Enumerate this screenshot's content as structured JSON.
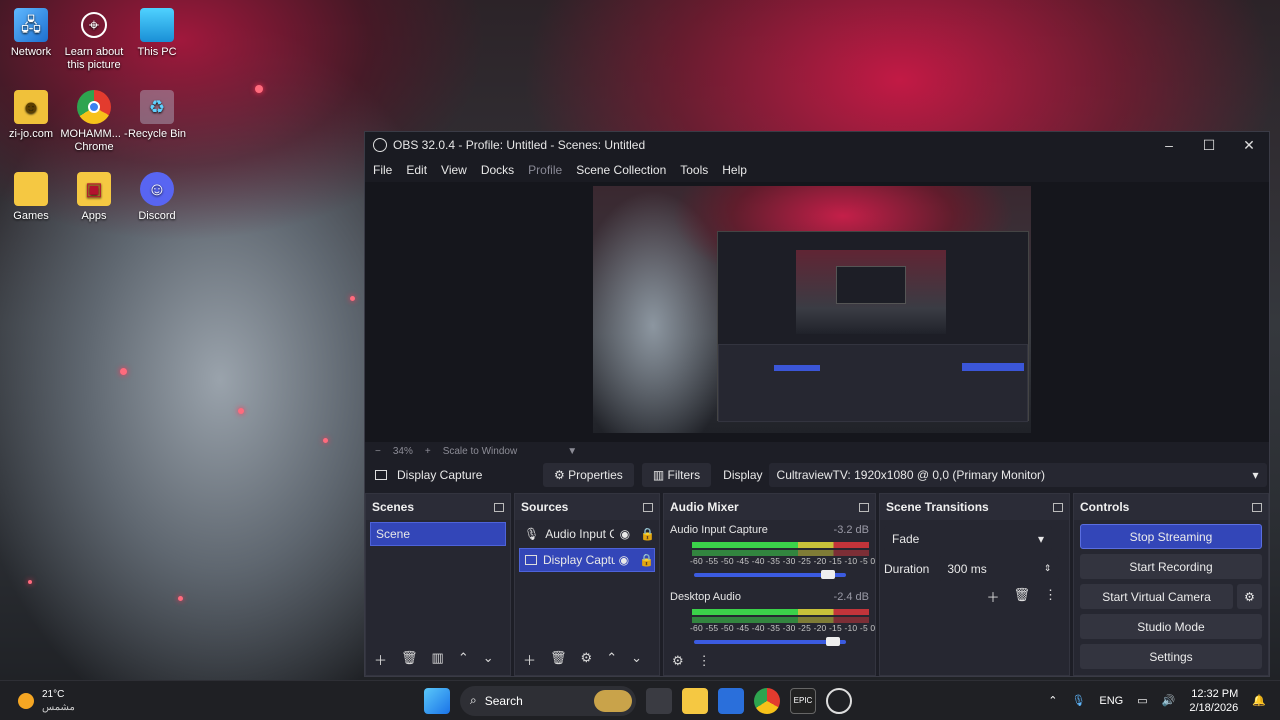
{
  "desktop": {
    "icons": [
      {
        "label": "Network",
        "icon": "network-icon"
      },
      {
        "label": "Learn about this picture",
        "icon": "learn-icon"
      },
      {
        "label": "This PC",
        "icon": "this-pc-icon"
      },
      {
        "label": "zi-jo.com",
        "icon": "user-folder-icon"
      },
      {
        "label": "MOHAMM... - Chrome",
        "icon": "chrome-icon"
      },
      {
        "label": "Recycle Bin",
        "icon": "recycle-bin-icon"
      },
      {
        "label": "Games",
        "icon": "folder-icon"
      },
      {
        "label": "Apps",
        "icon": "apps-folder-icon"
      },
      {
        "label": "Discord",
        "icon": "discord-icon"
      }
    ]
  },
  "obs": {
    "title": "OBS 32.0.4 - Profile: Untitled - Scenes: Untitled",
    "menu": [
      "File",
      "Edit",
      "View",
      "Docks",
      "Profile",
      "Scene Collection",
      "Tools",
      "Help"
    ],
    "zoom": {
      "minus": "−",
      "level": "34%",
      "plus": "+",
      "scale_mode": "Scale to Window"
    },
    "source_bar": {
      "source_name": "Display Capture",
      "properties": "Properties",
      "filters": "Filters",
      "display_label": "Display",
      "display_value": "CultraviewTV: 1920x1080 @ 0,0 (Primary Monitor)"
    },
    "scenes": {
      "title": "Scenes",
      "items": [
        "Scene"
      ]
    },
    "sources": {
      "title": "Sources",
      "items": [
        "Audio Input C",
        "Display Captu"
      ]
    },
    "mixer": {
      "title": "Audio Mixer",
      "ticks": "-60 -55 -50 -45 -40 -35 -30 -25 -20 -15 -10 -5 0",
      "channels": [
        {
          "name": "Audio Input Capture",
          "db": "-3.2 dB",
          "level": 0.93
        },
        {
          "name": "Desktop Audio",
          "db": "-2.4 dB",
          "level": 0.96
        }
      ]
    },
    "transitions": {
      "title": "Scene Transitions",
      "type": "Fade",
      "duration_label": "Duration",
      "duration_value": "300 ms"
    },
    "controls": {
      "title": "Controls",
      "stop_streaming": "Stop Streaming",
      "start_recording": "Start Recording",
      "start_virtual_camera": "Start Virtual Camera",
      "studio_mode": "Studio Mode",
      "settings": "Settings"
    }
  },
  "taskbar": {
    "weather_temp": "21°C",
    "weather_desc": "مشمس",
    "search": "Search",
    "language": "ENG",
    "time": "12:32 PM",
    "date": "2/18/2026"
  }
}
